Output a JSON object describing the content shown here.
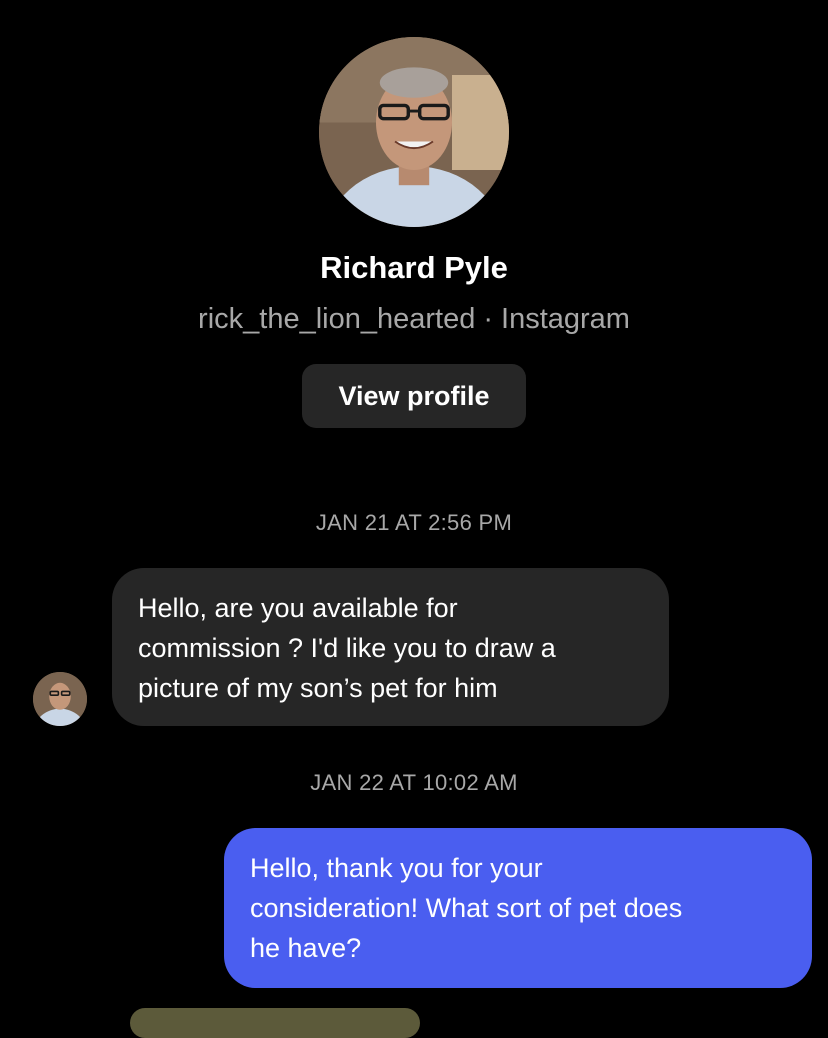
{
  "profile": {
    "name": "Richard Pyle",
    "username": "rick_the_lion_hearted",
    "separator": "·",
    "platform": "Instagram",
    "view_profile_label": "View profile",
    "avatar_icon": "profile-photo"
  },
  "messages": [
    {
      "timestamp": "JAN 21 AT 2:56 PM",
      "direction": "incoming",
      "lines": [
        "Hello, are you available for",
        "commission ? I'd like you to draw a",
        "picture of my son’s pet for him"
      ]
    },
    {
      "timestamp": "JAN 22 AT 10:02 AM",
      "direction": "outgoing",
      "lines": [
        "Hello, thank you for your",
        "consideration! What sort of pet does",
        "he have?"
      ]
    }
  ],
  "colors": {
    "background": "#000000",
    "incoming_bubble": "#262626",
    "outgoing_bubble": "#4a5ef0",
    "secondary_text": "#a8a8a8",
    "button_bg": "#262626"
  }
}
